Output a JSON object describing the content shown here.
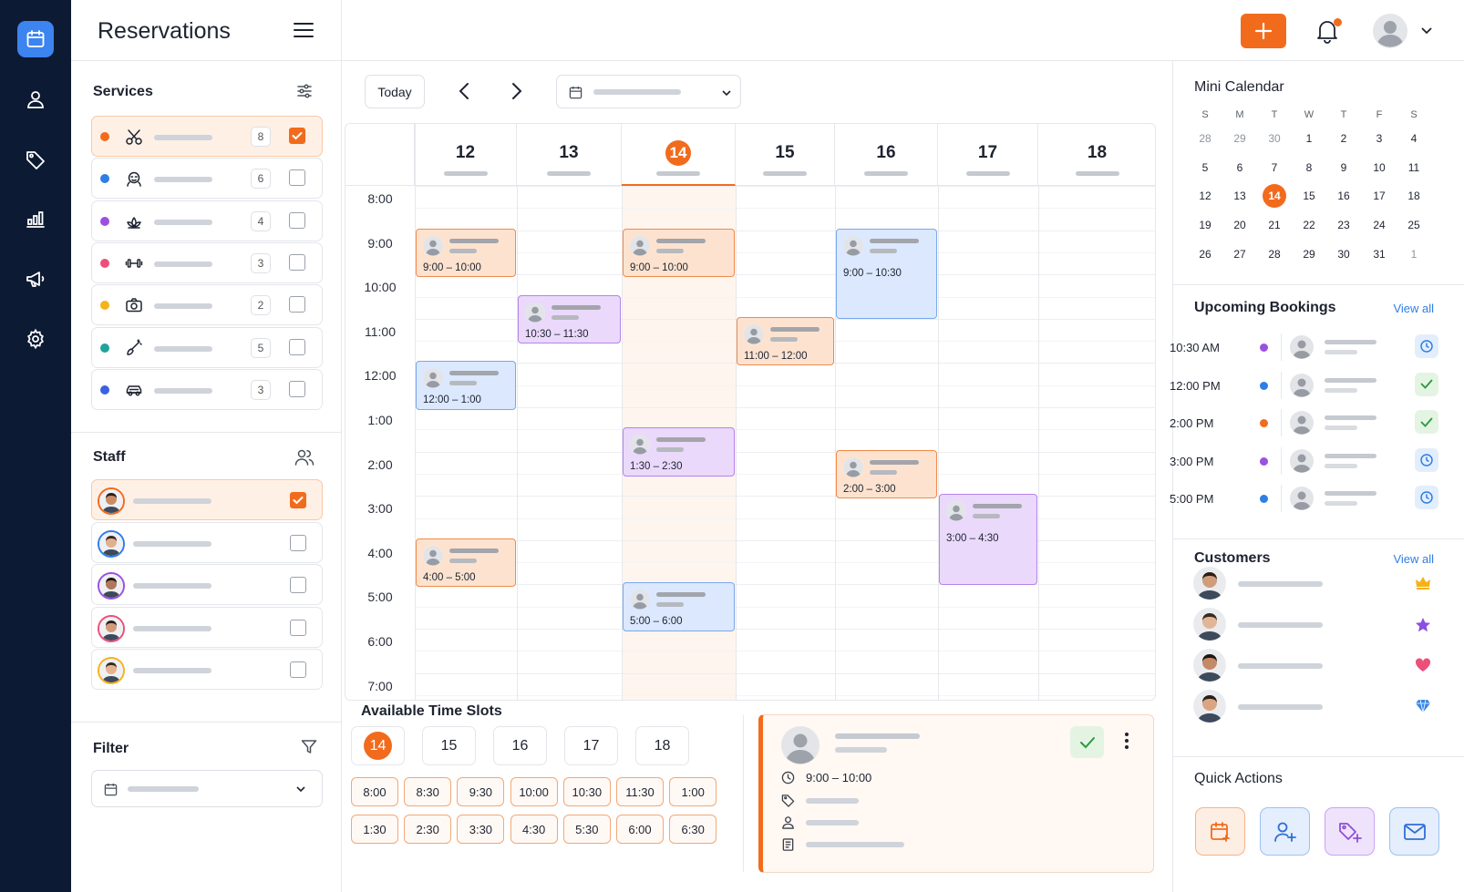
{
  "sidebar_title": "Reservations",
  "services": {
    "title": "Services",
    "items": [
      {
        "icon": "scissors-icon",
        "count": "8",
        "checked": true,
        "dot": "#f26b1d"
      },
      {
        "icon": "face-massage-icon",
        "count": "6",
        "checked": false,
        "dot": "#2f7de6"
      },
      {
        "icon": "lotus-icon",
        "count": "4",
        "checked": false,
        "dot": "#9b51e0"
      },
      {
        "icon": "dumbbell-icon",
        "count": "3",
        "checked": false,
        "dot": "#ec4f7a"
      },
      {
        "icon": "camera-icon",
        "count": "2",
        "checked": false,
        "dot": "#f5b21a"
      },
      {
        "icon": "brush-icon",
        "count": "5",
        "checked": false,
        "dot": "#1fa39a"
      },
      {
        "icon": "car-icon",
        "count": "3",
        "checked": false,
        "dot": "#3a62e0"
      }
    ]
  },
  "staff": {
    "title": "Staff",
    "checked": [
      true,
      false,
      false,
      false,
      false
    ]
  },
  "filter": {
    "title": "Filter"
  },
  "toolbar": {
    "today": "Today"
  },
  "calendar": {
    "days": [
      "12",
      "13",
      "14",
      "15",
      "16",
      "17",
      "18"
    ],
    "today": "14",
    "times": [
      "8:00",
      "9:00",
      "10:00",
      "11:00",
      "12:00",
      "1:00",
      "2:00",
      "3:00",
      "4:00",
      "5:00",
      "6:00",
      "7:00"
    ],
    "events": [
      {
        "day": 0,
        "start": 1,
        "end": 2.1,
        "color": "orange",
        "time": "9:00 – 10:00"
      },
      {
        "day": 1,
        "start": 2.5,
        "end": 3.6,
        "color": "purple",
        "time": "10:30 – 11:30"
      },
      {
        "day": 0,
        "start": 4,
        "end": 5.1,
        "color": "blue",
        "time": "12:00 – 1:00"
      },
      {
        "day": 0,
        "start": 8,
        "end": 9.1,
        "color": "orange",
        "time": "4:00 – 5:00"
      },
      {
        "day": 2,
        "start": 1,
        "end": 2.1,
        "color": "orange",
        "time": "9:00 – 10:00"
      },
      {
        "day": 2,
        "start": 5.5,
        "end": 6.6,
        "color": "purple",
        "time": "1:30 – 2:30"
      },
      {
        "day": 2,
        "start": 9,
        "end": 10.1,
        "color": "blue",
        "time": "5:00 – 6:00"
      },
      {
        "day": 3,
        "start": 3,
        "end": 4.1,
        "color": "orange",
        "time": "11:00 – 12:00"
      },
      {
        "day": 4,
        "start": 1,
        "end": 3.05,
        "color": "blue",
        "time": "9:00 – 10:30"
      },
      {
        "day": 4,
        "start": 6,
        "end": 7.1,
        "color": "orange",
        "time": "2:00 – 3:00"
      },
      {
        "day": 5,
        "start": 7,
        "end": 9.05,
        "color": "purple",
        "time": "3:00 – 4:30"
      }
    ]
  },
  "slots": {
    "title": "Available Time Slots",
    "days": [
      "14",
      "15",
      "16",
      "17",
      "18"
    ],
    "times": [
      "8:00",
      "8:30",
      "9:30",
      "10:00",
      "10:30",
      "11:30",
      "1:00",
      "1:30",
      "2:30",
      "3:30",
      "4:30",
      "5:30",
      "6:00",
      "6:30"
    ]
  },
  "detail": {
    "time": "9:00 – 10:00"
  },
  "mini_calendar": {
    "title": "Mini Calendar",
    "weekdays": [
      "S",
      "M",
      "T",
      "W",
      "T",
      "F",
      "S"
    ],
    "weeks": [
      [
        "28",
        "29",
        "30",
        "1",
        "2",
        "3",
        "4"
      ],
      [
        "5",
        "6",
        "7",
        "8",
        "9",
        "10",
        "11"
      ],
      [
        "12",
        "13",
        "14",
        "15",
        "16",
        "17",
        "18"
      ],
      [
        "19",
        "20",
        "21",
        "22",
        "23",
        "24",
        "25"
      ],
      [
        "26",
        "27",
        "28",
        "29",
        "30",
        "31",
        "1"
      ]
    ],
    "today": "14"
  },
  "upcoming": {
    "title": "Upcoming Bookings",
    "view_all": "View all",
    "items": [
      {
        "time": "10:30 AM",
        "dot": "#9b51e0",
        "status": "clock-icon"
      },
      {
        "time": "12:00 PM",
        "dot": "#2f7de6",
        "status": "check-icon"
      },
      {
        "time": "2:00 PM",
        "dot": "#f26b1d",
        "status": "check-icon"
      },
      {
        "time": "3:00 PM",
        "dot": "#9b51e0",
        "status": "clock-icon"
      },
      {
        "time": "5:00 PM",
        "dot": "#2f7de6",
        "status": "clock-icon"
      }
    ]
  },
  "customers": {
    "title": "Customers",
    "view_all": "View all",
    "badges": [
      "crown-icon",
      "star-icon",
      "heart-icon",
      "diamond-icon"
    ]
  },
  "quick_actions": {
    "title": "Quick Actions",
    "items": [
      "calendar-add-icon",
      "user-add-icon",
      "tag-add-icon",
      "mail-icon"
    ]
  }
}
